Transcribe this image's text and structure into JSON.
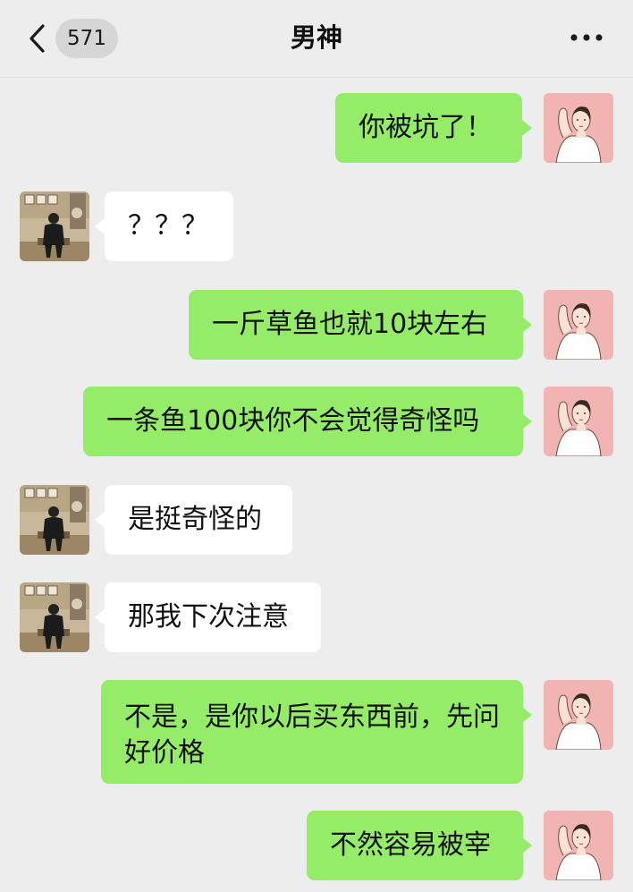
{
  "header": {
    "unread_count": "571",
    "title": "男神",
    "back_icon": "chevron-left-icon",
    "more_icon": "more-dots-icon"
  },
  "colors": {
    "background": "#ededed",
    "my_bubble": "#95ec69",
    "their_bubble": "#ffffff",
    "unread_badge": "#d6d6d6"
  },
  "messages": [
    {
      "sender": "me",
      "text": "你被坑了！"
    },
    {
      "sender": "them",
      "text": "？？？"
    },
    {
      "sender": "me",
      "text": "一斤草鱼也就10块左右"
    },
    {
      "sender": "me",
      "text": "一条鱼100块你不会觉得奇怪吗"
    },
    {
      "sender": "them",
      "text": "是挺奇怪的"
    },
    {
      "sender": "them",
      "text": "那我下次注意"
    },
    {
      "sender": "me",
      "text": "不是，是你以后买东西前，先问好价格"
    },
    {
      "sender": "me",
      "text": "不然容易被宰"
    }
  ]
}
